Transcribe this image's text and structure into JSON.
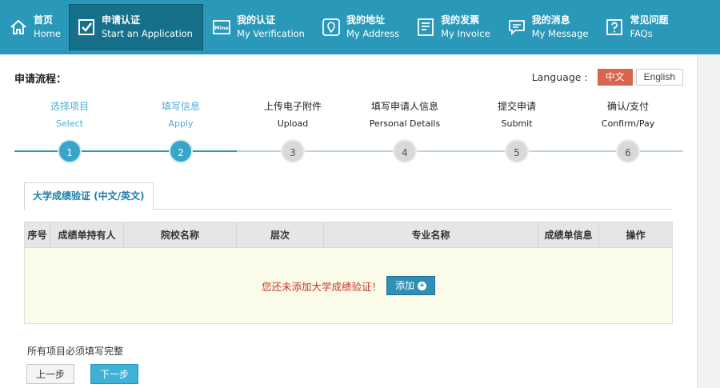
{
  "nav": [
    {
      "cn": "首页",
      "en": "Home",
      "icon": "home-icon",
      "active": false
    },
    {
      "cn": "申请认证",
      "en": "Start an Application",
      "icon": "checkbox-icon",
      "active": true
    },
    {
      "cn": "我的认证",
      "en": "My Verification",
      "icon": "mine-card-icon",
      "active": false
    },
    {
      "cn": "我的地址",
      "en": "My Address",
      "icon": "location-pin-icon",
      "active": false
    },
    {
      "cn": "我的发票",
      "en": "My Invoice",
      "icon": "invoice-icon",
      "active": false
    },
    {
      "cn": "我的消息",
      "en": "My Message",
      "icon": "message-icon",
      "active": false
    },
    {
      "cn": "常见问题",
      "en": "FAQs",
      "icon": "question-icon",
      "active": false
    }
  ],
  "mine_icon_text": "Mine",
  "heading": "申请流程：",
  "language": {
    "label": "Language :",
    "options": [
      "中文",
      "English"
    ],
    "selected": "中文"
  },
  "steps": [
    {
      "cn": "选择项目",
      "en": "Select",
      "num": "1",
      "done": true
    },
    {
      "cn": "填写信息",
      "en": "Apply",
      "num": "2",
      "done": true
    },
    {
      "cn": "上传电子附件",
      "en": "Upload",
      "num": "3",
      "done": false
    },
    {
      "cn": "填写申请人信息",
      "en": "Personal Details",
      "num": "4",
      "done": false
    },
    {
      "cn": "提交申请",
      "en": "Submit",
      "num": "5",
      "done": false
    },
    {
      "cn": "确认/支付",
      "en": "Confirm/Pay",
      "num": "6",
      "done": false
    }
  ],
  "tab": {
    "label": "大学成绩验证 (中文/英文)"
  },
  "table": {
    "headers": [
      "序号",
      "成绩单持有人",
      "院校名称",
      "层次",
      "专业名称",
      "成绩单信息",
      "操作"
    ],
    "empty_message": "您还未添加大学成绩验证！",
    "add_label": "添加"
  },
  "required_note": "所有项目必须填写完整",
  "buttons": {
    "prev": "上一步",
    "next": "下一步"
  },
  "colors": {
    "nav_bg": "#2a98b8",
    "nav_active": "#16708a",
    "step_done": "#39a6c8",
    "lang_selected": "#d9644e",
    "empty_message": "#c0392b",
    "next_button": "#3fb0d6"
  }
}
